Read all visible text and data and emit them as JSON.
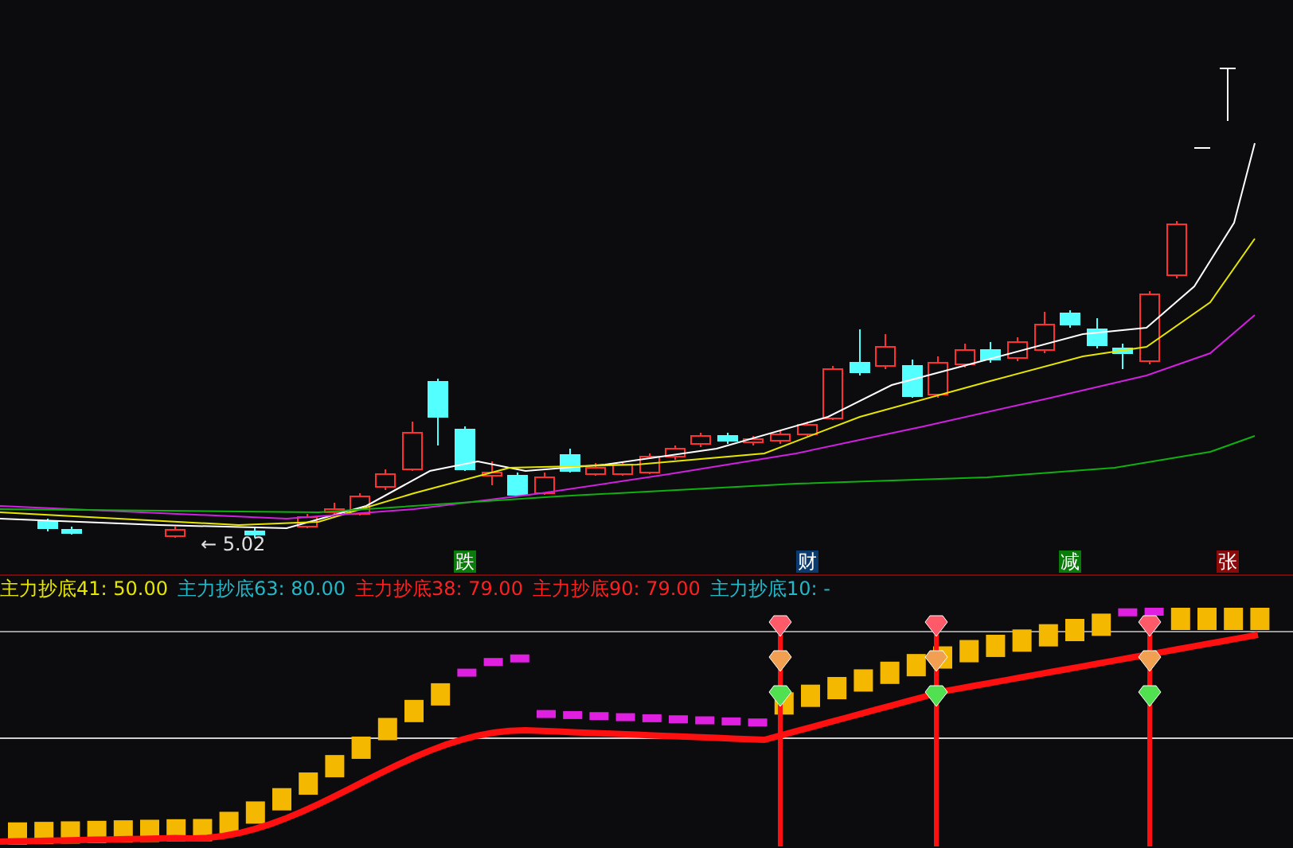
{
  "price_chart": {
    "low_marker": "← 5.02"
  },
  "event_tags": [
    {
      "label": "跌",
      "color": "#0a7a0a"
    },
    {
      "label": "财",
      "color": "#0b3a6e"
    },
    {
      "label": "减",
      "color": "#0a7a0a"
    },
    {
      "label": "张",
      "color": "#8a0a0a"
    }
  ],
  "indicator_legend": [
    {
      "text": "主力抄底41: 50.00",
      "color": "#e6e600"
    },
    {
      "text": "主力抄底63: 80.00",
      "color": "#22b8c8"
    },
    {
      "text": "主力抄底38: 79.00",
      "color": "#ff2020"
    },
    {
      "text": "主力抄底90: 79.00",
      "color": "#ff2020"
    },
    {
      "text": "主力抄底10: -",
      "color": "#22b8c8"
    }
  ]
}
